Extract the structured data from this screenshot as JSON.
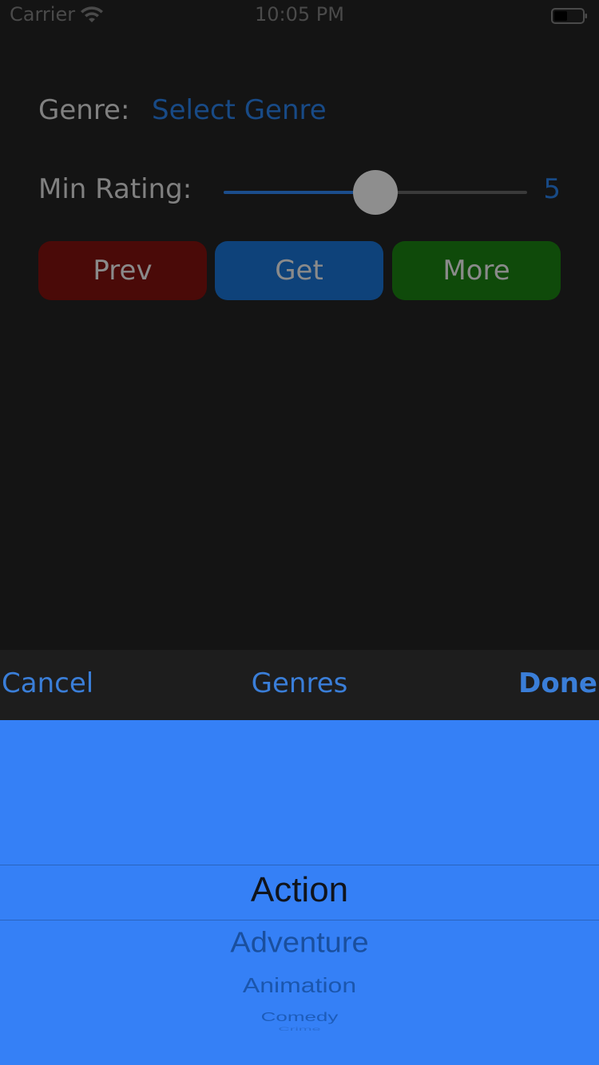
{
  "status_bar": {
    "carrier": "Carrier",
    "time": "10:05 PM",
    "wifi_icon": "wifi-icon",
    "battery_icon": "battery-icon"
  },
  "form": {
    "genre_label": "Genre:",
    "genre_value": "Select Genre",
    "rating_label": "Min Rating:",
    "rating_value": "5",
    "slider": {
      "min": 0,
      "max": 10,
      "value": 5
    }
  },
  "buttons": {
    "prev": "Prev",
    "get": "Get",
    "more": "More"
  },
  "toolbar": {
    "cancel": "Cancel",
    "title": "Genres",
    "done": "Done"
  },
  "picker": {
    "selected": "Action",
    "items": [
      "Action",
      "Adventure",
      "Animation",
      "Comedy",
      "Crime"
    ]
  },
  "colors": {
    "background": "#141414",
    "accent": "#3a7ed8",
    "picker_background": "#3580f6",
    "prev_button": "#4a0a08",
    "get_button": "#0e427a",
    "more_button": "#0f4a0a"
  }
}
